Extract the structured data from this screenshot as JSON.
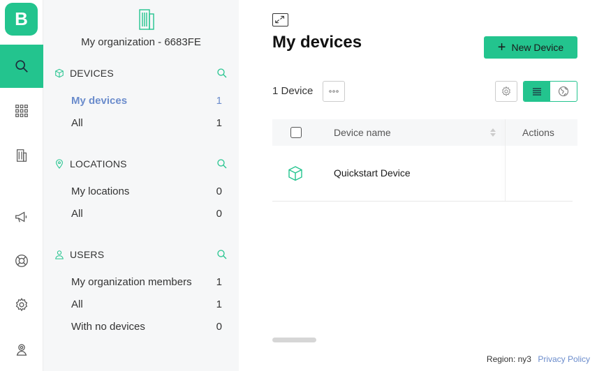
{
  "rail": {
    "logo_letter": "B",
    "items": [
      {
        "name": "search",
        "icon": "search-icon",
        "active": true
      },
      {
        "name": "apps",
        "icon": "grid-icon",
        "active": false
      },
      {
        "name": "organization",
        "icon": "building-icon",
        "active": false
      },
      {
        "name": "announcements",
        "icon": "megaphone-icon",
        "active": false
      },
      {
        "name": "help",
        "icon": "lifebuoy-icon",
        "active": false
      },
      {
        "name": "settings",
        "icon": "gear-icon",
        "active": false
      },
      {
        "name": "account",
        "icon": "user-badge-icon",
        "active": false
      }
    ],
    "accent": "#23c48e"
  },
  "panel": {
    "org_name": "My organization - 6683FE",
    "sections": [
      {
        "title": "DEVICES",
        "icon": "cube-icon",
        "items": [
          {
            "label": "My devices",
            "count": "1",
            "active": true
          },
          {
            "label": "All",
            "count": "1",
            "active": false
          }
        ]
      },
      {
        "title": "LOCATIONS",
        "icon": "pin-icon",
        "items": [
          {
            "label": "My locations",
            "count": "0",
            "active": false
          },
          {
            "label": "All",
            "count": "0",
            "active": false
          }
        ]
      },
      {
        "title": "USERS",
        "icon": "user-icon",
        "items": [
          {
            "label": "My organization members",
            "count": "1",
            "active": false
          },
          {
            "label": "All",
            "count": "1",
            "active": false
          },
          {
            "label": "With no devices",
            "count": "0",
            "active": false
          }
        ]
      }
    ]
  },
  "main": {
    "title": "My devices",
    "new_button": "New Device",
    "device_count": "1 Device",
    "table": {
      "headers": {
        "name": "Device name",
        "actions": "Actions"
      },
      "rows": [
        {
          "name": "Quickstart Device",
          "icon": "cube-icon"
        }
      ]
    }
  },
  "footer": {
    "region": "Region: ny3",
    "privacy": "Privacy Policy"
  }
}
